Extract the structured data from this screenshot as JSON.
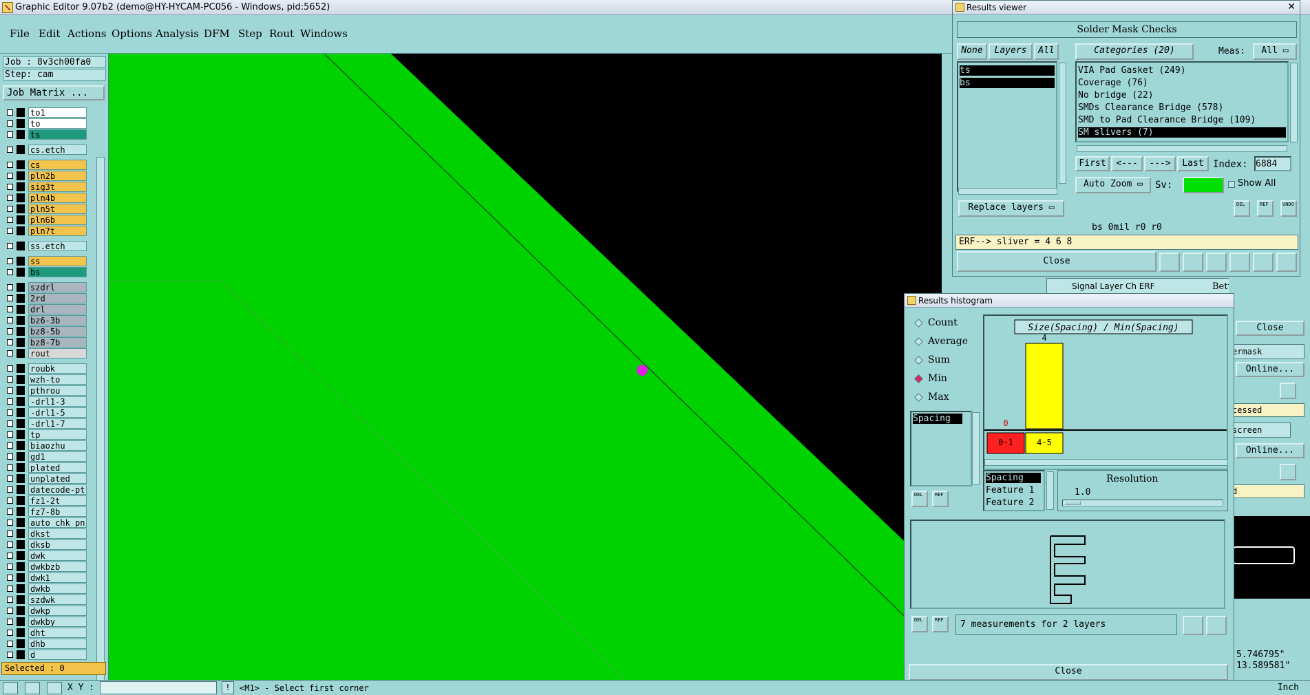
{
  "titlebar": {
    "title": "Graphic Editor 9.07b2 (demo@HY-HYCAM-PC056 - Windows, pid:5652)"
  },
  "menu": [
    "File",
    "Edit",
    "Actions",
    "Options",
    "Analysis",
    "DFM",
    "Step",
    "Rout",
    "Windows"
  ],
  "left": {
    "job": "Job : 8v3ch00fa0",
    "step": "Step: cam",
    "job_matrix": "Job Matrix ...",
    "layers": [
      {
        "name": "to1",
        "color": "#ffffff"
      },
      {
        "name": "to",
        "color": "#ffffff"
      },
      {
        "name": "ts",
        "color": "#1f9a7c"
      },
      {
        "name": "cs.etch",
        "color": "#bfe6e6"
      },
      {
        "name": "cs",
        "color": "#f3c44b"
      },
      {
        "name": "pln2b",
        "color": "#f3c44b"
      },
      {
        "name": "sig3t",
        "color": "#f3c44b"
      },
      {
        "name": "pln4b",
        "color": "#f3c44b"
      },
      {
        "name": "pln5t",
        "color": "#f3c44b"
      },
      {
        "name": "pln6b",
        "color": "#f3c44b"
      },
      {
        "name": "pln7t",
        "color": "#f3c44b"
      },
      {
        "name": "ss.etch",
        "color": "#bfe6e6"
      },
      {
        "name": "ss",
        "color": "#f3c44b"
      },
      {
        "name": "bs",
        "color": "#1f9a7c"
      },
      {
        "name": "szdrl",
        "color": "#a9b6be"
      },
      {
        "name": "2rd",
        "color": "#a9b6be"
      },
      {
        "name": "drl",
        "color": "#a9b6be"
      },
      {
        "name": "bz6-3b",
        "color": "#a9b6be"
      },
      {
        "name": "bz8-5b",
        "color": "#a9b6be"
      },
      {
        "name": "bz8-7b",
        "color": "#a9b6be"
      },
      {
        "name": "rout",
        "color": "#d8d8d8"
      },
      {
        "name": "roubk",
        "color": "#bfe6e6"
      },
      {
        "name": "wzh-to",
        "color": "#bfe6e6"
      },
      {
        "name": "pthrou",
        "color": "#bfe6e6"
      },
      {
        "name": "-drl1-3",
        "color": "#bfe6e6"
      },
      {
        "name": "-drl1-5",
        "color": "#bfe6e6"
      },
      {
        "name": "-drl1-7",
        "color": "#bfe6e6"
      },
      {
        "name": "tp",
        "color": "#bfe6e6"
      },
      {
        "name": "biaozhu",
        "color": "#bfe6e6"
      },
      {
        "name": "gd1",
        "color": "#bfe6e6"
      },
      {
        "name": "plated",
        "color": "#bfe6e6"
      },
      {
        "name": "unplated",
        "color": "#bfe6e6"
      },
      {
        "name": "datecode-pt",
        "color": "#bfe6e6"
      },
      {
        "name": "fz1-2t",
        "color": "#bfe6e6"
      },
      {
        "name": "fz7-8b",
        "color": "#bfe6e6"
      },
      {
        "name": "auto_chk_pn",
        "color": "#bfe6e6"
      },
      {
        "name": "dkst",
        "color": "#bfe6e6"
      },
      {
        "name": "dksb",
        "color": "#bfe6e6"
      },
      {
        "name": "dwk",
        "color": "#bfe6e6"
      },
      {
        "name": "dwkbzb",
        "color": "#bfe6e6"
      },
      {
        "name": "dwk1",
        "color": "#bfe6e6"
      },
      {
        "name": "dwkb",
        "color": "#bfe6e6"
      },
      {
        "name": "szdwk",
        "color": "#bfe6e6"
      },
      {
        "name": "dwkp",
        "color": "#bfe6e6"
      },
      {
        "name": "dwkby",
        "color": "#bfe6e6"
      },
      {
        "name": "dht",
        "color": "#bfe6e6"
      },
      {
        "name": "dhb",
        "color": "#bfe6e6"
      },
      {
        "name": "d",
        "color": "#bfe6e6"
      }
    ],
    "selected": "Selected : 0"
  },
  "bottom": {
    "xy_label": "X Y :",
    "xy_value": "",
    "warn": "!",
    "prompt": "<M1> - Select first corner",
    "unit": "Inch"
  },
  "results_viewer": {
    "title": "Results viewer",
    "header": "Solder Mask Checks",
    "btn_none": "None",
    "btn_layers": "Layers",
    "btn_all": "All",
    "btn_categories": "Categories (20)",
    "meas_label": "Meas:",
    "meas_value": "All",
    "layers": [
      "ts",
      "bs"
    ],
    "categories": [
      "VIA Pad Gasket (249)",
      "Coverage (76)",
      "No bridge (22)",
      "SMDs Clearance Bridge (578)",
      "SMD to Pad Clearance Bridge (109)",
      "SM slivers (7)"
    ],
    "first": "First",
    "prev": "<---",
    "next": "--->",
    "last": "Last",
    "index_label": "Index:",
    "index_value": "6884",
    "auto_zoom": "Auto Zoom",
    "sv_label": "Sv:",
    "show_all": "Show All",
    "replace_layers": "Replace layers",
    "status": "bs 0mil  r0  r0",
    "erf": "ERF--> sliver = 4 6 8",
    "close": "Close",
    "icons": [
      "DEL",
      "REF",
      "UNDO"
    ]
  },
  "histogram": {
    "title": "Results histogram",
    "modes": [
      "Count",
      "Average",
      "Sum",
      "Min",
      "Max"
    ],
    "selected_mode": "Min",
    "list_items": [
      "Spacing"
    ],
    "chart_title": "Size(Spacing) / Min(Spacing)",
    "feature_items": [
      "Spacing",
      "Feature 1",
      "Feature 2"
    ],
    "resolution_label": "Resolution",
    "resolution_value": "1.0",
    "measurements": "7 measurements for 2 layers",
    "close": "Close",
    "icons": [
      "DEL",
      "REF"
    ]
  },
  "chart_data": {
    "type": "bar",
    "title": "Size(Spacing) / Min(Spacing)",
    "categories": [
      "0-1",
      "4-5"
    ],
    "values": [
      0,
      4
    ],
    "bar_colors": [
      "#ff2020",
      "#ffff00"
    ],
    "ylim": [
      0,
      4
    ]
  },
  "background_fragment": {
    "tab_label": "Signal Layer Ch ERF",
    "between": "Between Midpoint",
    "close": "Close",
    "mask": "ermask",
    "online1": "Online...",
    "processed": "cessed",
    "screen": "screen",
    "online2": "Online...",
    "d": "d",
    "coord_x": "5.746795\"",
    "coord_y": "13.589581\""
  }
}
